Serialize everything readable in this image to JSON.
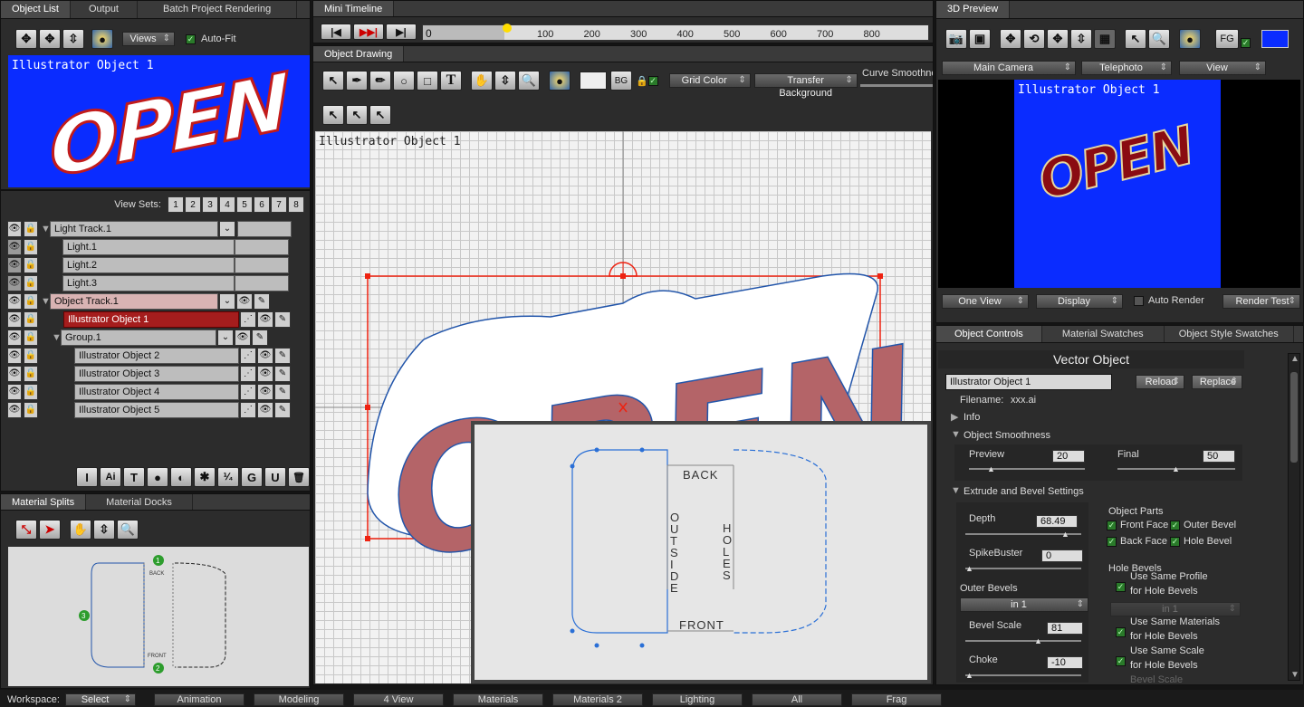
{
  "left_tabs": [
    "Object List",
    "Output",
    "Batch Project Rendering"
  ],
  "views_label": "Views",
  "autofit_label": "Auto-Fit",
  "object_preview_title": "Illustrator Object 1",
  "open_text": "OPEN",
  "view_sets_label": "View Sets:",
  "view_sets": [
    "1",
    "2",
    "3",
    "4",
    "5",
    "6",
    "7",
    "8"
  ],
  "tracks": [
    {
      "label": "Light Track.1"
    },
    {
      "label": "Light.1"
    },
    {
      "label": "Light.2"
    },
    {
      "label": "Light.3"
    },
    {
      "label": "Object Track.1"
    },
    {
      "label": "Illustrator Object 1"
    },
    {
      "label": "Group.1"
    },
    {
      "label": "Illustrator Object 2"
    },
    {
      "label": "Illustrator Object 3"
    },
    {
      "label": "Illustrator Object 4"
    },
    {
      "label": "Illustrator Object 5"
    }
  ],
  "bottom_tool_labels": [
    "I",
    "Ai",
    "T",
    "●",
    "◐",
    "✱",
    "⅟₄",
    "G",
    "U",
    "🗑"
  ],
  "material_tabs": [
    "Material Splits",
    "Material Docks"
  ],
  "material_mini": {
    "back": "BACK",
    "front": "FRONT",
    "markers": [
      "1",
      "2",
      "3"
    ]
  },
  "timeline": {
    "tab": "Mini Timeline",
    "current": "0",
    "ticks": [
      "100",
      "200",
      "300",
      "400",
      "500",
      "600",
      "700",
      "800"
    ]
  },
  "drawing": {
    "tab": "Object Drawing",
    "bg_label": "BG",
    "grid_color": "Grid Color",
    "transfer": "Transfer Background",
    "curve": "Curve Smoothne",
    "title": "Illustrator Object 1"
  },
  "profile": {
    "back": "BACK",
    "front": "FRONT",
    "outside": "OUTSIDE",
    "holes": "HOLES"
  },
  "preview3d": {
    "tab": "3D Preview",
    "fg": "FG",
    "camera": "Main Camera",
    "lens": "Telephoto",
    "view": "View",
    "title": "Illustrator Object 1",
    "one_view": "One View",
    "display": "Display",
    "auto_render": "Auto Render",
    "render_test": "Render Test"
  },
  "controls": {
    "tabs": [
      "Object Controls",
      "Material Swatches",
      "Object Style Swatches"
    ],
    "header": "Vector Object",
    "object_name": "Illustrator Object 1",
    "reload": "Reload",
    "replace": "Replace",
    "filename_label": "Filename:",
    "filename": "xxx.ai",
    "info": "Info",
    "smoothness": "Object Smoothness",
    "preview_label": "Preview",
    "preview_val": "20",
    "final_label": "Final",
    "final_val": "50",
    "extrude": "Extrude and Bevel Settings",
    "depth_label": "Depth",
    "depth_val": "68.49",
    "spike_label": "SpikeBuster",
    "spike_val": "0",
    "outer_bevels": "Outer Bevels",
    "outer_bevel_sel": "in 1",
    "bevel_scale_label": "Bevel Scale",
    "bevel_scale_val": "81",
    "choke_label": "Choke",
    "choke_val": "-10",
    "parts_label": "Object Parts",
    "parts": [
      "Front Face",
      "Outer Bevel",
      "Back Face",
      "Hole Bevel"
    ],
    "hole_bevels": "Hole Bevels",
    "same_profile": "Use Same Profile",
    "for_hole1": "for Hole Bevels",
    "hole_sel": "in 1",
    "same_materials": "Use Same Materials",
    "for_hole2": "for Hole Bevels",
    "same_scale": "Use Same Scale",
    "for_hole3": "for Hole Bevels",
    "bevel_scale2": "Bevel Scale"
  },
  "workspace": {
    "label": "Workspace:",
    "select": "Select",
    "buttons": [
      "Animation",
      "Modeling",
      "4 View",
      "Materials",
      "Materials 2",
      "Lighting",
      "All",
      "Frag"
    ]
  }
}
